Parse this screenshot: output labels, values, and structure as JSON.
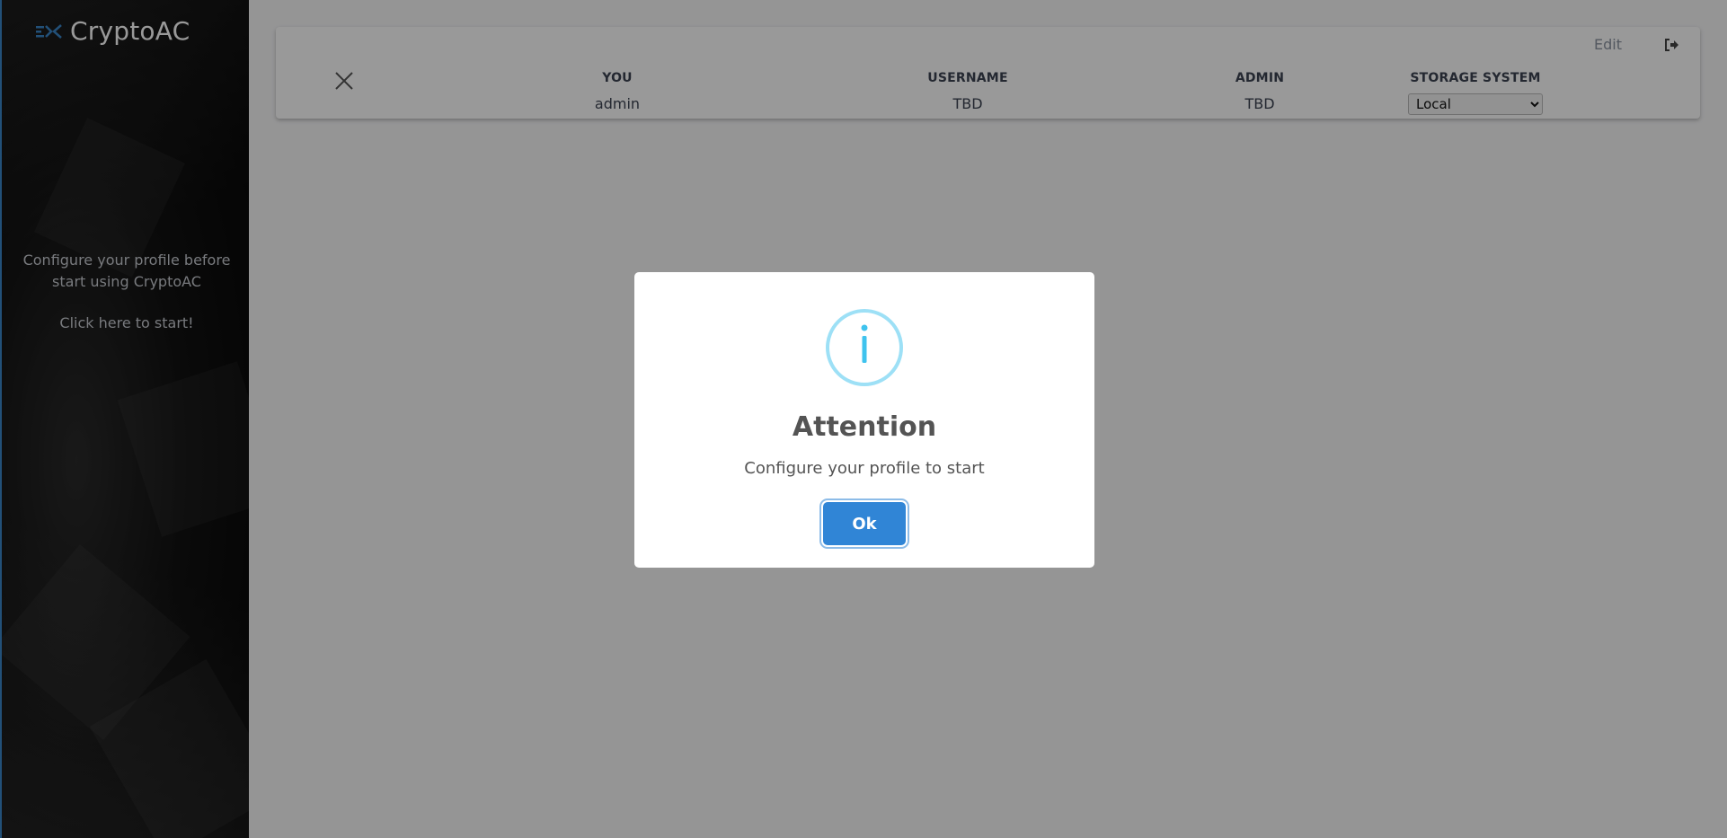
{
  "app": {
    "brand": "CryptoAC"
  },
  "sidebar": {
    "message": "Configure your profile before start using CryptoAC",
    "start_link": "Click here to start!"
  },
  "profile": {
    "columns": [
      {
        "header": "YOU",
        "value": "admin"
      },
      {
        "header": "USERNAME",
        "value": "TBD"
      },
      {
        "header": "ADMIN",
        "value": "TBD"
      },
      {
        "header": "STORAGE SYSTEM",
        "value": "Local"
      }
    ],
    "storage_options": [
      "Local"
    ],
    "edit_label": "Edit"
  },
  "dialog": {
    "title": "Attention",
    "text": "Configure your profile to start",
    "ok_label": "Ok",
    "icon": "info-icon"
  },
  "colors": {
    "accent": "#3085d6",
    "info_icon": "#87dcf3",
    "dialog_text": "#545454"
  }
}
